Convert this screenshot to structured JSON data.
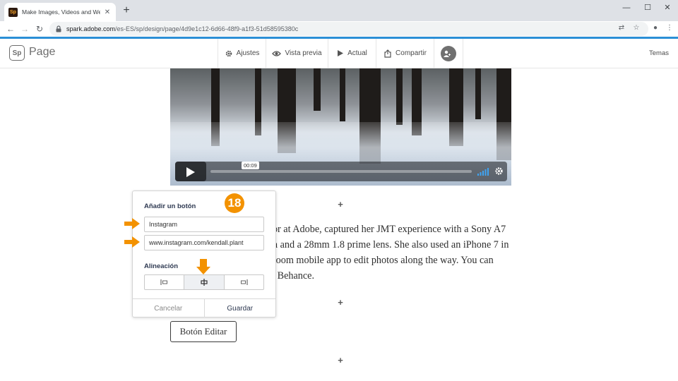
{
  "browser": {
    "tab_title": "Make Images, Videos and Web S",
    "tab_favicon": "Sp",
    "url_host": "spark.adobe.com",
    "url_path": "/es-ES/sp/design/page/4d9e1c12-6d66-48f9-a1f3-51d58595380c"
  },
  "app": {
    "logo_text": "Sp",
    "product_name": "Page",
    "nav": {
      "ajustes": "Ajustes",
      "vista_previa": "Vista previa",
      "actual": "Actual",
      "compartir": "Compartir"
    },
    "temas": "Temas"
  },
  "video": {
    "timestamp": "00:09"
  },
  "body_text": {
    "line1": "tor at Adobe, captured her JMT experience with a Sony A7",
    "line2": "ra and a 28mm 1.8 prime lens. She also used an iPhone 7 in",
    "line3": "troom mobile app to edit photos along the way. You can",
    "line4": "d Behance."
  },
  "panel": {
    "heading": "Añadir un botón",
    "button_label_value": "Instagram",
    "button_link_value": "www.instagram.com/kendall.plant",
    "alignment_label": "Alineación",
    "alignment_selected": "center",
    "cancel_label": "Cancelar",
    "save_label": "Guardar"
  },
  "step_number": "18",
  "edit_button_label": "Botón Editar",
  "colors": {
    "accent": "#f39200",
    "panel_heading": "#2f3a52",
    "browser_accent": "#2b8fd6"
  }
}
